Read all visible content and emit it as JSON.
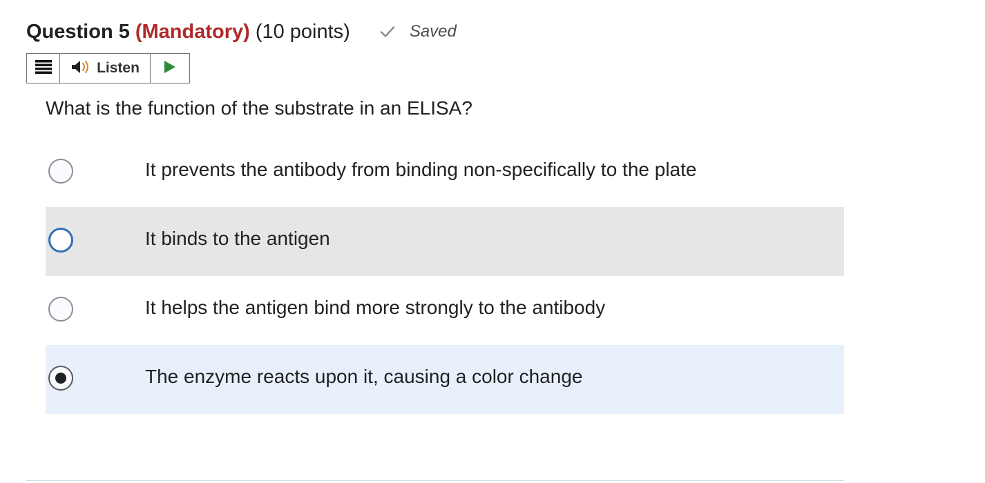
{
  "question": {
    "title": "Question 5",
    "mandatory": "(Mandatory)",
    "points": "(10 points)",
    "status": "Saved",
    "status_icon": "checkmark-icon",
    "text": "What is the function of the substrate in an ELISA?",
    "colors": {
      "mandatory": "#b12929",
      "hover_row": "#e6e6e6",
      "selected_row": "#e8f1fb",
      "focus_ring": "#2f6eb5",
      "play_icon": "#2e8b3c"
    }
  },
  "toolbar": {
    "menu_icon": "hamburger-menu-icon",
    "speaker_icon": "speaker-icon",
    "listen_label": "Listen",
    "play_icon": "play-icon"
  },
  "options": [
    {
      "label": "It prevents the antibody from binding non-specifically to the plate",
      "state": "unselected"
    },
    {
      "label": "It binds to the antigen",
      "state": "hover"
    },
    {
      "label": "It helps the antigen bind more strongly to the antibody",
      "state": "unselected"
    },
    {
      "label": "The enzyme reacts upon it, causing a color change",
      "state": "selected"
    }
  ]
}
